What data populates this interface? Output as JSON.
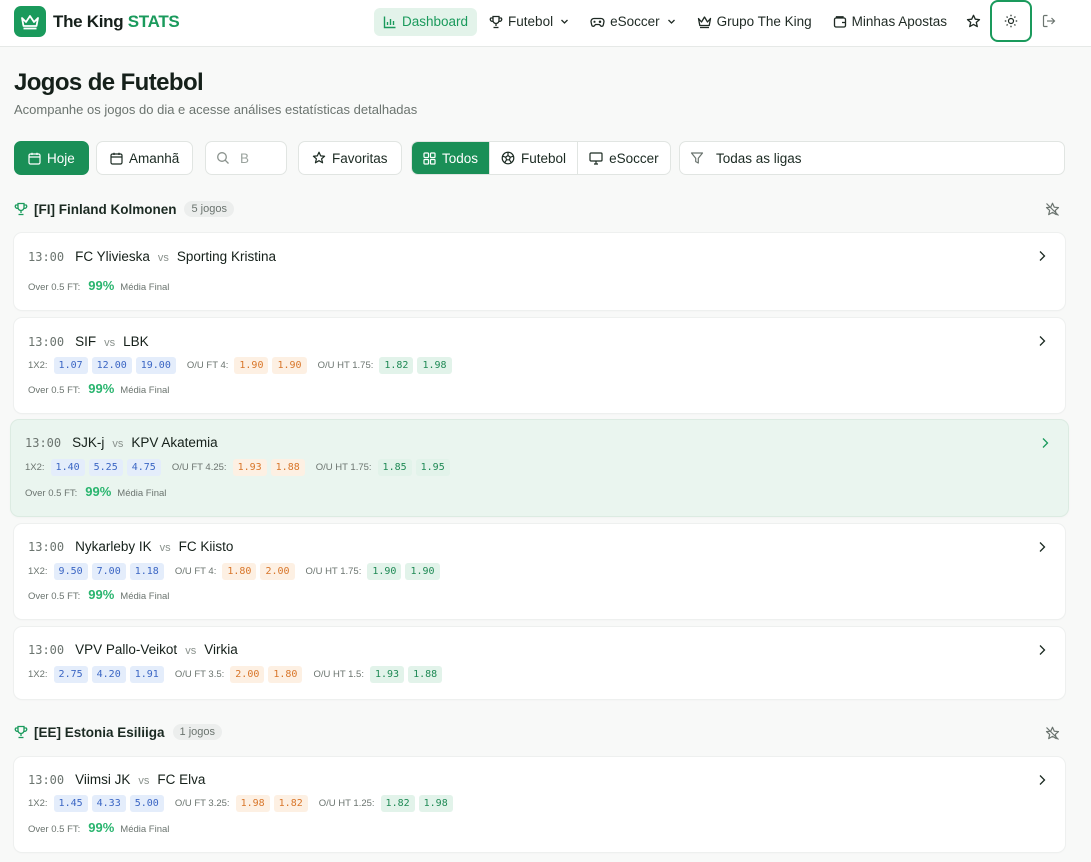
{
  "brand": {
    "name_primary": "The King",
    "name_accent": "STATS",
    "accent_color": "#1a9a5c"
  },
  "nav": {
    "items": [
      {
        "label": "Dashboard",
        "icon": "bar-chart-icon",
        "active": true
      },
      {
        "label": "Futebol",
        "icon": "trophy-icon",
        "dropdown": true
      },
      {
        "label": "eSoccer",
        "icon": "gamepad-icon",
        "dropdown": true
      },
      {
        "label": "Grupo The King",
        "icon": "crown-icon"
      },
      {
        "label": "Minhas Apostas",
        "icon": "wallet-icon"
      }
    ]
  },
  "page": {
    "title": "Jogos de Futebol",
    "subtitle": "Acompanhe os jogos do dia e acesse análises estatísticas detalhadas"
  },
  "filters": {
    "today": "Hoje",
    "tomorrow": "Amanhã",
    "search_placeholder": "B",
    "favorites": "Favoritas",
    "segments": [
      "Todos",
      "Futebol",
      "eSoccer"
    ],
    "league_select": "Todas as ligas"
  },
  "labels": {
    "vs": "vs",
    "x12": "1X2:",
    "over_label": "Over 0.5 FT:",
    "media_final": "Média Final"
  },
  "leagues": [
    {
      "name": "[FI] Finland Kolmonen",
      "count": "5 jogos",
      "matches": [
        {
          "time": "13:00",
          "home": "FC Ylivieska",
          "away": "Sporting Kristina",
          "over_pct": "99%"
        },
        {
          "time": "13:00",
          "home": "SIF",
          "away": "LBK",
          "x12": [
            "1.07",
            "12.00",
            "19.00"
          ],
          "ou_ft_label": "O/U FT 4:",
          "ou_ft": [
            "1.90",
            "1.90"
          ],
          "ou_ht_label": "O/U HT 1.75:",
          "ou_ht": [
            "1.82",
            "1.98"
          ],
          "over_pct": "99%"
        },
        {
          "time": "13:00",
          "home": "SJK-j",
          "away": "KPV Akatemia",
          "x12": [
            "1.40",
            "5.25",
            "4.75"
          ],
          "ou_ft_label": "O/U FT 4.25:",
          "ou_ft": [
            "1.93",
            "1.88"
          ],
          "ou_ht_label": "O/U HT 1.75:",
          "ou_ht": [
            "1.85",
            "1.95"
          ],
          "over_pct": "99%"
        },
        {
          "time": "13:00",
          "home": "Nykarleby IK",
          "away": "FC Kiisto",
          "x12": [
            "9.50",
            "7.00",
            "1.18"
          ],
          "ou_ft_label": "O/U FT 4:",
          "ou_ft": [
            "1.80",
            "2.00"
          ],
          "ou_ht_label": "O/U HT 1.75:",
          "ou_ht": [
            "1.90",
            "1.90"
          ],
          "over_pct": "99%"
        },
        {
          "time": "13:00",
          "home": "VPV Pallo-Veikot",
          "away": "Virkia",
          "x12": [
            "2.75",
            "4.20",
            "1.91"
          ],
          "ou_ft_label": "O/U FT 3.5:",
          "ou_ft": [
            "2.00",
            "1.80"
          ],
          "ou_ht_label": "O/U HT 1.5:",
          "ou_ht": [
            "1.93",
            "1.88"
          ]
        }
      ]
    },
    {
      "name": "[EE] Estonia Esiliiga",
      "count": "1 jogos",
      "matches": [
        {
          "time": "13:00",
          "home": "Viimsi JK",
          "away": "FC Elva",
          "x12": [
            "1.45",
            "4.33",
            "5.00"
          ],
          "ou_ft_label": "O/U FT 3.25:",
          "ou_ft": [
            "1.98",
            "1.82"
          ],
          "ou_ht_label": "O/U HT 1.25:",
          "ou_ht": [
            "1.82",
            "1.98"
          ],
          "over_pct": "99%"
        }
      ]
    }
  ]
}
